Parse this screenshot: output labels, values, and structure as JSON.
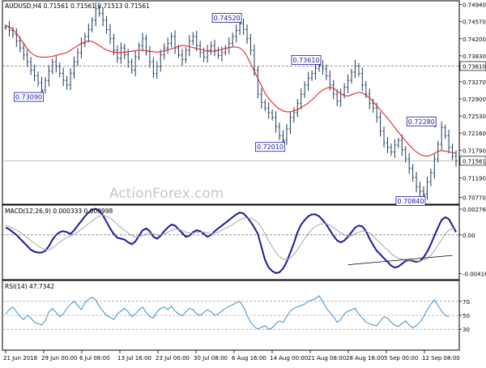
{
  "chart_data": [
    {
      "type": "line",
      "title": "AUDUSD,H4  0.71561 0.71561 0.71513 0.71561",
      "symbol": "AUDUSD",
      "timeframe": "H4",
      "ylim": [
        0.7062,
        0.7502
      ],
      "y_ticks": [
        "0.74940",
        "0.74570",
        "0.74200",
        "0.73830",
        "0.73610",
        "0.73270",
        "0.72900",
        "0.72530",
        "0.72160",
        "0.71790",
        "0.71561",
        "0.71190",
        "0.70770"
      ],
      "current_price": "0.71561",
      "reference_level": "0.73610",
      "x_ticks": [
        "21 Jun 2018",
        "29 Jun 00:00",
        "6 Jul 08:00",
        "13 Jul 16:00",
        "23 Jul 00:00",
        "30 Jul 08:00",
        "6 Aug 16:00",
        "14 Aug 00:00",
        "21 Aug 08:00",
        "28 Aug 16:00",
        "5 Sep 00:00",
        "12 Sep 08:00"
      ],
      "series": [
        {
          "values": [
            0.7445,
            0.7438,
            0.743,
            0.7415,
            0.74,
            0.7385,
            0.737,
            0.7352,
            0.734,
            0.7325,
            0.7309,
            0.733,
            0.735,
            0.737,
            0.736,
            0.7345,
            0.733,
            0.732,
            0.7345,
            0.737,
            0.739,
            0.741,
            0.7425,
            0.744,
            0.746,
            0.7485,
            0.7475,
            0.746,
            0.744,
            0.742,
            0.7395,
            0.7378,
            0.74,
            0.7385,
            0.737,
            0.7352,
            0.738,
            0.7405,
            0.742,
            0.7392,
            0.737,
            0.7345,
            0.736,
            0.7385,
            0.74,
            0.741,
            0.7425,
            0.74,
            0.7385,
            0.7375,
            0.7395,
            0.7415,
            0.7425,
            0.7405,
            0.739,
            0.738,
            0.7395,
            0.7405,
            0.7395,
            0.7384,
            0.739,
            0.74,
            0.741,
            0.7425,
            0.7438,
            0.7452,
            0.744,
            0.742,
            0.7395,
            0.7352,
            0.73,
            0.7282,
            0.727,
            0.726,
            0.725,
            0.723,
            0.721,
            0.7201,
            0.7225,
            0.725,
            0.726,
            0.728,
            0.73,
            0.732,
            0.7335,
            0.7345,
            0.7356,
            0.7361,
            0.7355,
            0.734,
            0.732,
            0.73,
            0.7285,
            0.73,
            0.7315,
            0.733,
            0.7348,
            0.7361,
            0.7345,
            0.732,
            0.73,
            0.728,
            0.727,
            0.725,
            0.722,
            0.7195,
            0.7185,
            0.7175,
            0.719,
            0.72,
            0.718,
            0.716,
            0.714,
            0.712,
            0.71,
            0.709,
            0.7084,
            0.711,
            0.713,
            0.716,
            0.7192,
            0.7228,
            0.721,
            0.7185,
            0.7166,
            0.7156
          ],
          "style": "ohlc-bars",
          "color": "#1e3a5f"
        },
        {
          "values": [
            0.745,
            0.7445,
            0.744,
            0.7432,
            0.742,
            0.741,
            0.7398,
            0.739,
            0.7384,
            0.7381,
            0.738,
            0.738,
            0.7381,
            0.7382,
            0.7384,
            0.7386,
            0.7388,
            0.739,
            0.7395,
            0.74,
            0.7405,
            0.741,
            0.7413,
            0.7415,
            0.7414,
            0.741,
            0.7405,
            0.74,
            0.7396,
            0.7393,
            0.7391,
            0.739,
            0.739,
            0.7391,
            0.7392,
            0.7393,
            0.7394,
            0.7395,
            0.7395,
            0.7394,
            0.7393,
            0.7392,
            0.7391,
            0.7392,
            0.7394,
            0.7396,
            0.7398,
            0.7401,
            0.7404,
            0.7405,
            0.7405,
            0.7403,
            0.7401,
            0.7399,
            0.7397,
            0.7395,
            0.7393,
            0.7393,
            0.7393,
            0.7395,
            0.7397,
            0.7399,
            0.7401,
            0.7402,
            0.7402,
            0.74,
            0.7394,
            0.7382,
            0.7366,
            0.735,
            0.7334,
            0.7318,
            0.7302,
            0.7291,
            0.7282,
            0.7274,
            0.7268,
            0.7264,
            0.7262,
            0.7262,
            0.7264,
            0.7267,
            0.7271,
            0.7276,
            0.7281,
            0.7288,
            0.7295,
            0.7303,
            0.7309,
            0.7313,
            0.7315,
            0.7313,
            0.7307,
            0.7301,
            0.7297,
            0.7296,
            0.7299,
            0.7302,
            0.7304,
            0.7303,
            0.7298,
            0.7292,
            0.7284,
            0.7275,
            0.7266,
            0.7257,
            0.7248,
            0.7238,
            0.7228,
            0.7218,
            0.7208,
            0.7199,
            0.719,
            0.7182,
            0.7175,
            0.717,
            0.7167,
            0.7166,
            0.7168,
            0.7172,
            0.7177,
            0.7178,
            0.7177,
            0.7175,
            0.7174,
            0.7172
          ],
          "style": "moving-average",
          "color": "#e0262b"
        }
      ],
      "annotations": [
        {
          "label": "0.73090",
          "value": 0.7309
        },
        {
          "label": "0.74520",
          "value": 0.7452
        },
        {
          "label": "0.72010",
          "value": 0.7201
        },
        {
          "label": "0.73610",
          "value": 0.7361
        },
        {
          "label": "0.72280",
          "value": 0.7228
        },
        {
          "label": "0.70840",
          "value": 0.7084
        }
      ],
      "watermark": "ActionForex.com"
    },
    {
      "type": "line",
      "title": "MACD(12,26,9) 0.000333 0.000998",
      "ylim": [
        -0.0048,
        0.0032
      ],
      "y_ticks": [
        "0.002764",
        "0.00",
        "-0.004165"
      ],
      "series": [
        {
          "values": [
            0.0008,
            0.0006,
            0.0003,
            0.0,
            -0.0004,
            -0.0008,
            -0.0012,
            -0.0016,
            -0.0018,
            -0.0019,
            -0.0019,
            -0.0017,
            -0.0012,
            -0.0005,
            0.0,
            0.0003,
            0.0004,
            0.0003,
            0.0001,
            0.0005,
            0.001,
            0.0015,
            0.002,
            0.0024,
            0.0027,
            0.0028,
            0.0026,
            0.0021,
            0.0014,
            0.0007,
            0.0001,
            -0.0003,
            -0.0004,
            -0.0005,
            -0.0008,
            -0.001,
            -0.0007,
            -0.0001,
            0.0005,
            0.0007,
            0.0004,
            -0.0002,
            -0.0004,
            -0.0001,
            0.0004,
            0.0008,
            0.0011,
            0.001,
            0.0006,
            0.0002,
            -0.0002,
            -0.0001,
            0.0003,
            0.0005,
            0.0004,
            0.0001,
            -0.0002,
            0.0,
            0.0004,
            0.0007,
            0.001,
            0.0013,
            0.0016,
            0.0019,
            0.0022,
            0.0024,
            0.0023,
            0.0019,
            0.0014,
            0.0008,
            0.0001,
            -0.0013,
            -0.0027,
            -0.0035,
            -0.0039,
            -0.0041,
            -0.004,
            -0.0036,
            -0.0029,
            -0.0019,
            -0.0009,
            0.0003,
            0.0011,
            0.0016,
            0.002,
            0.0022,
            0.0022,
            0.002,
            0.0016,
            0.0011,
            0.0005,
            -0.0001,
            -0.0006,
            -0.0008,
            -0.0006,
            -0.0002,
            0.0003,
            0.0008,
            0.001,
            0.0009,
            0.0004,
            -0.0004,
            -0.0011,
            -0.0017,
            -0.0021,
            -0.0025,
            -0.0029,
            -0.0033,
            -0.0035,
            -0.0034,
            -0.0031,
            -0.0028,
            -0.0027,
            -0.0028,
            -0.0029,
            -0.0028,
            -0.0024,
            -0.0018,
            -0.001,
            -0.0001,
            0.0008,
            0.0016,
            0.0019,
            0.0017,
            0.001,
            0.0003
          ],
          "name": "MACD",
          "color": "#1a1a9e"
        },
        {
          "values": [
            0.001,
            0.0009,
            0.0007,
            0.0005,
            0.0003,
            0.0,
            -0.0003,
            -0.0006,
            -0.0009,
            -0.0012,
            -0.0014,
            -0.0016,
            -0.0016,
            -0.0014,
            -0.0011,
            -0.0008,
            -0.0005,
            -0.0003,
            -0.0001,
            0.0001,
            0.0003,
            0.0006,
            0.0009,
            0.0012,
            0.0015,
            0.0018,
            0.002,
            0.0021,
            0.002,
            0.0018,
            0.0015,
            0.0011,
            0.0008,
            0.0005,
            0.0002,
            -0.0001,
            -0.0002,
            -0.0002,
            -0.0001,
            0.0001,
            0.0002,
            0.0001,
            0.0,
            0.0,
            0.0001,
            0.0003,
            0.0005,
            0.0006,
            0.0006,
            0.0005,
            0.0003,
            0.0002,
            0.0002,
            0.0003,
            0.0003,
            0.0003,
            0.0002,
            0.0001,
            0.0002,
            0.0003,
            0.0005,
            0.0007,
            0.0009,
            0.0011,
            0.0014,
            0.0016,
            0.0018,
            0.0018,
            0.0018,
            0.0016,
            0.0013,
            0.0008,
            0.0001,
            -0.0006,
            -0.0013,
            -0.0019,
            -0.0023,
            -0.0026,
            -0.0026,
            -0.0025,
            -0.0021,
            -0.0016,
            -0.001,
            -0.0004,
            0.0001,
            0.0006,
            0.0009,
            0.0011,
            0.0012,
            0.0012,
            0.001,
            0.0008,
            0.0005,
            0.0002,
            0.0,
            -0.0001,
            -0.0001,
            0.0001,
            0.0003,
            0.0004,
            0.0004,
            0.0002,
            -0.0001,
            -0.0005,
            -0.0009,
            -0.0013,
            -0.0016,
            -0.002,
            -0.0023,
            -0.0025,
            -0.0026,
            -0.0027,
            -0.0027,
            -0.0027,
            -0.0028,
            -0.0028,
            -0.0027,
            -0.0025,
            -0.0022,
            -0.0017,
            -0.0011,
            -0.0005,
            0.0001,
            0.0005,
            0.0007,
            0.0007
          ],
          "name": "Signal",
          "color": "#a8a8a8"
        }
      ],
      "trendline": [
        [
          95,
          -0.0032
        ],
        [
          124,
          -0.0022
        ]
      ]
    },
    {
      "type": "line",
      "title": "RSI(14) 47.7342",
      "ylim": [
        0,
        100
      ],
      "y_ticks": [
        "70",
        "50",
        "30"
      ],
      "series": [
        {
          "values": [
            52,
            58,
            62,
            55,
            48,
            44,
            50,
            46,
            40,
            38,
            36,
            42,
            55,
            60,
            54,
            48,
            52,
            60,
            66,
            70,
            64,
            58,
            68,
            73,
            76,
            72,
            63,
            56,
            50,
            47,
            44,
            52,
            56,
            60,
            55,
            48,
            52,
            58,
            62,
            54,
            48,
            46,
            55,
            60,
            62,
            58,
            63,
            56,
            52,
            49,
            55,
            60,
            58,
            52,
            50,
            54,
            58,
            55,
            50,
            52,
            56,
            60,
            63,
            65,
            68,
            70,
            62,
            50,
            40,
            34,
            30,
            33,
            35,
            30,
            32,
            38,
            42,
            40,
            48,
            56,
            60,
            62,
            64,
            66,
            70,
            72,
            74,
            78,
            70,
            60,
            54,
            48,
            40,
            44,
            52,
            56,
            58,
            60,
            52,
            46,
            40,
            38,
            36,
            35,
            42,
            48,
            46,
            40,
            36,
            34,
            38,
            42,
            36,
            32,
            35,
            40,
            48,
            58,
            66,
            72,
            64,
            56,
            50,
            47.73
          ],
          "name": "RSI",
          "color": "#3c8fd0"
        }
      ]
    }
  ]
}
